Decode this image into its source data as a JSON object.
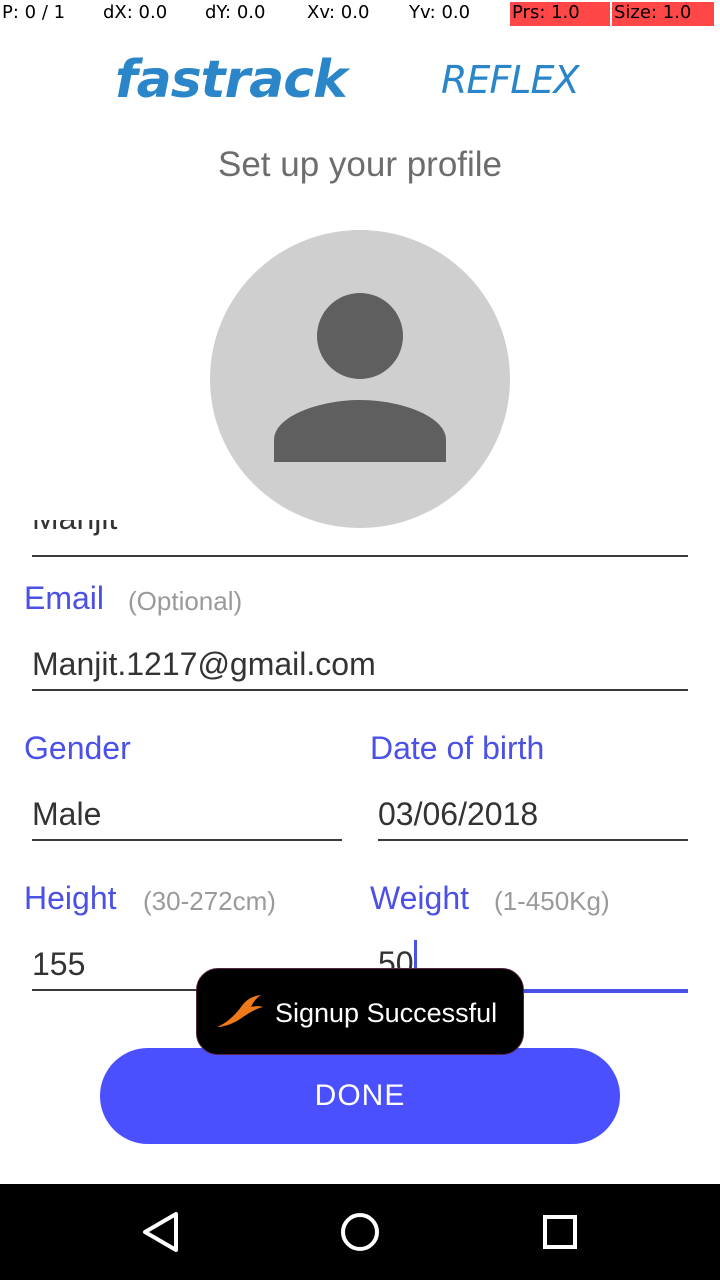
{
  "debug": {
    "p": "P: 0 / 1",
    "dx": "dX: 0.0",
    "dy": "dY: 0.0",
    "xv": "Xv: 0.0",
    "yv": "Yv: 0.0",
    "prs": "Prs: 1.0",
    "size": "Size: 1.0"
  },
  "logo": {
    "brand": "fastrack",
    "product": "REFLEX",
    "color": "#2a86c8"
  },
  "page_title": "Set up your profile",
  "avatar": {
    "icon": "person-icon"
  },
  "form": {
    "name_value": "Manjit",
    "email": {
      "label": "Email",
      "hint": "(Optional)",
      "value": "Manjit.1217@gmail.com"
    },
    "gender": {
      "label": "Gender",
      "value": "Male"
    },
    "dob": {
      "label": "Date of birth",
      "value": "03/06/2018"
    },
    "height": {
      "label": "Height",
      "hint": "(30-272cm)",
      "value": "155"
    },
    "weight": {
      "label": "Weight",
      "hint": "(1-450Kg)",
      "value": "50"
    }
  },
  "done_button": "DONE",
  "toast": {
    "icon": "fastrack-swoosh-icon",
    "text": "Signup Successful"
  },
  "navbar": {
    "back": "back-icon",
    "home": "home-icon",
    "recents": "recents-icon"
  },
  "colors": {
    "accent": "#4b50e6",
    "button": "#4b50ff",
    "debug_highlight": "#ff4747"
  }
}
